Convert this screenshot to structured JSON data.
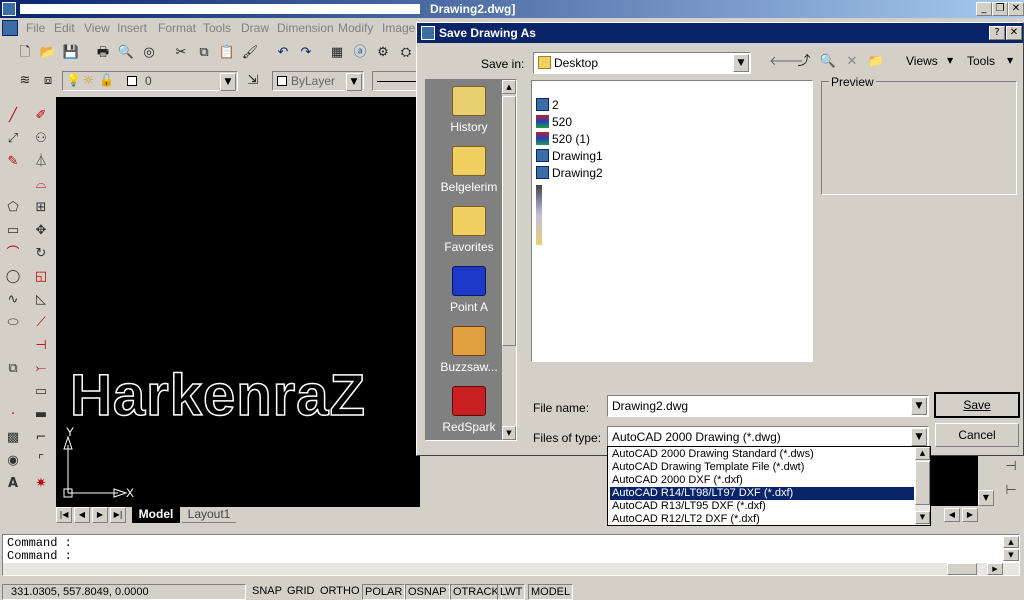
{
  "app": {
    "title": "Drawing2.dwg]"
  },
  "menu": [
    "File",
    "Edit",
    "View",
    "Insert",
    "Format",
    "Tools",
    "Draw",
    "Dimension",
    "Modify",
    "Image"
  ],
  "layers": {
    "layer_value": "0",
    "linetype_value": "ByLayer"
  },
  "canvas": {
    "text": "HarkenraZ",
    "axis_x": "X",
    "axis_y": "Y"
  },
  "layout_tabs": [
    "Model",
    "Layout1"
  ],
  "dialog": {
    "title": "Save Drawing As",
    "save_in_label": "Save in:",
    "save_in_value": "Desktop",
    "views_label": "Views",
    "tools_label": "Tools",
    "preview_label": "Preview",
    "places": [
      "History",
      "Belgelerim",
      "Favorites",
      "Point A",
      "Buzzsaw...",
      "RedSpark"
    ],
    "files": [
      "2",
      "520",
      "520 (1)",
      "Drawing1",
      "Drawing2"
    ],
    "file_name_label": "File name:",
    "file_name_value": "Drawing2.dwg",
    "file_type_label": "Files of type:",
    "file_type_value": "AutoCAD 2000 Drawing (*.dwg)",
    "save_button": "Save",
    "cancel_button": "Cancel",
    "type_options": [
      "AutoCAD 2000 Drawing Standard (*.dws)",
      "AutoCAD Drawing Template File (*.dwt)",
      "AutoCAD 2000 DXF (*.dxf)",
      "AutoCAD R14/LT98/LT97 DXF (*.dxf)",
      "AutoCAD R13/LT95 DXF (*.dxf)",
      "AutoCAD R12/LT2 DXF (*.dxf)"
    ],
    "selected_type_option": "AutoCAD R14/LT98/LT97 DXF (*.dxf)"
  },
  "command": {
    "line1": "Command :",
    "line2": "Command :"
  },
  "status": {
    "coords": "331.0305, 557.8049, 0.0000",
    "toggles": [
      "SNAP",
      "GRID",
      "ORTHO",
      "POLAR",
      "OSNAP",
      "OTRACK",
      "LWT",
      "MODEL"
    ]
  },
  "colors": {
    "titlebar": "#0a246a",
    "selection": "#0a246a",
    "canvas": "#000000"
  }
}
